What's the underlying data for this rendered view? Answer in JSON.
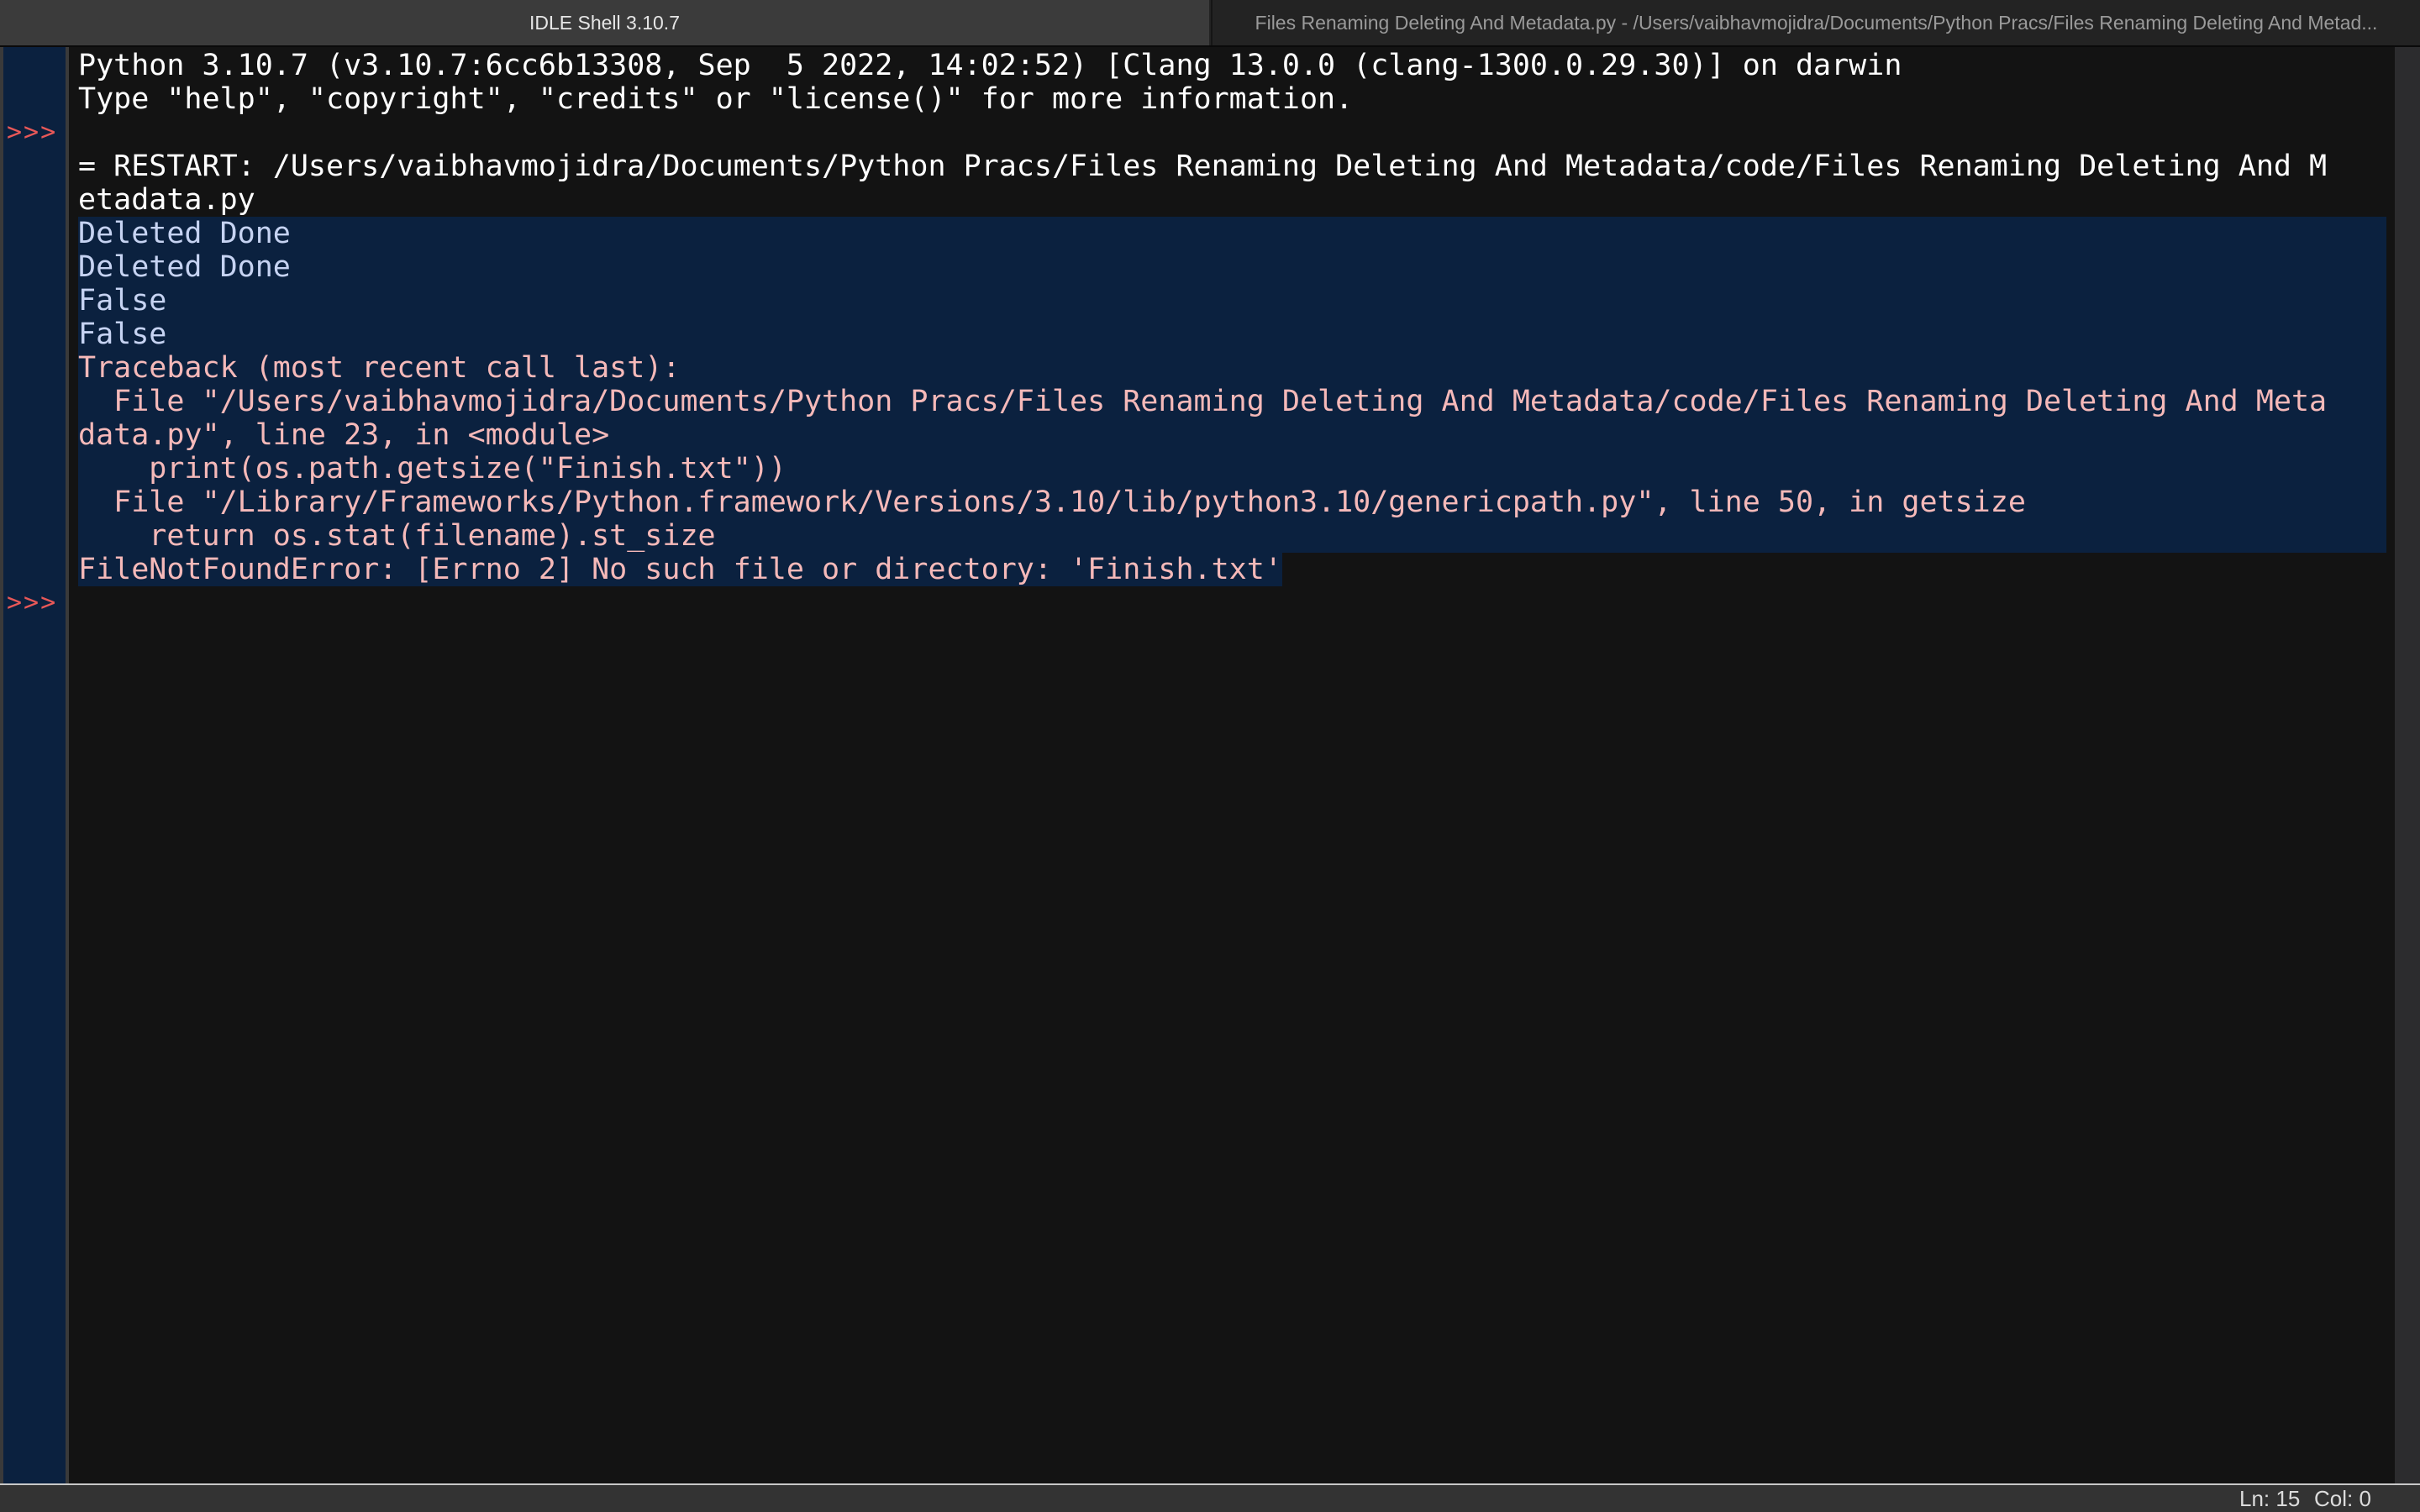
{
  "tabs": [
    {
      "label": "IDLE Shell 3.10.7",
      "active": true
    },
    {
      "label": "Files Renaming Deleting And Metadata.py - /Users/vaibhavmojidra/Documents/Python Pracs/Files Renaming Deleting And Metad...",
      "active": false
    }
  ],
  "gutter": {
    "prompt_symbol": ">>>"
  },
  "shell": {
    "lines": [
      {
        "text": "Python 3.10.7 (v3.10.7:6cc6b13308, Sep  5 2022, 14:02:52) [Clang 13.0.0 (clang-1300.0.29.30)] on darwin",
        "kind": "stdout"
      },
      {
        "text": "Type \"help\", \"copyright\", \"credits\" or \"license()\" for more information.",
        "kind": "stdout"
      },
      {
        "text": "",
        "kind": "prompt"
      },
      {
        "text": "= RESTART: /Users/vaibhavmojidra/Documents/Python Pracs/Files Renaming Deleting And Metadata/code/Files Renaming Deleting And M",
        "kind": "stdout"
      },
      {
        "text": "etadata.py",
        "kind": "stdout"
      },
      {
        "text": "Deleted Done",
        "kind": "output"
      },
      {
        "text": "Deleted Done",
        "kind": "output"
      },
      {
        "text": "False",
        "kind": "output"
      },
      {
        "text": "False",
        "kind": "output"
      },
      {
        "text": "Traceback (most recent call last):",
        "kind": "error"
      },
      {
        "text": "  File \"/Users/vaibhavmojidra/Documents/Python Pracs/Files Renaming Deleting And Metadata/code/Files Renaming Deleting And Meta",
        "kind": "error"
      },
      {
        "text": "data.py\", line 23, in <module>",
        "kind": "error"
      },
      {
        "text": "    print(os.path.getsize(\"Finish.txt\"))",
        "kind": "error"
      },
      {
        "text": "  File \"/Library/Frameworks/Python.framework/Versions/3.10/lib/python3.10/genericpath.py\", line 50, in getsize",
        "kind": "error"
      },
      {
        "text": "    return os.stat(filename).st_size",
        "kind": "error"
      },
      {
        "text": "FileNotFoundError: [Errno 2] No such file or directory: 'Finish.txt'",
        "kind": "error"
      },
      {
        "text": "",
        "kind": "prompt"
      }
    ]
  },
  "status": {
    "line": "Ln: 15",
    "col": "Col: 0"
  },
  "colors": {
    "prompt": "#e85858",
    "stdout": "#ffffff",
    "output": "#c6d3f2",
    "error": "#f5b9b9",
    "selection": "#0b213f"
  }
}
